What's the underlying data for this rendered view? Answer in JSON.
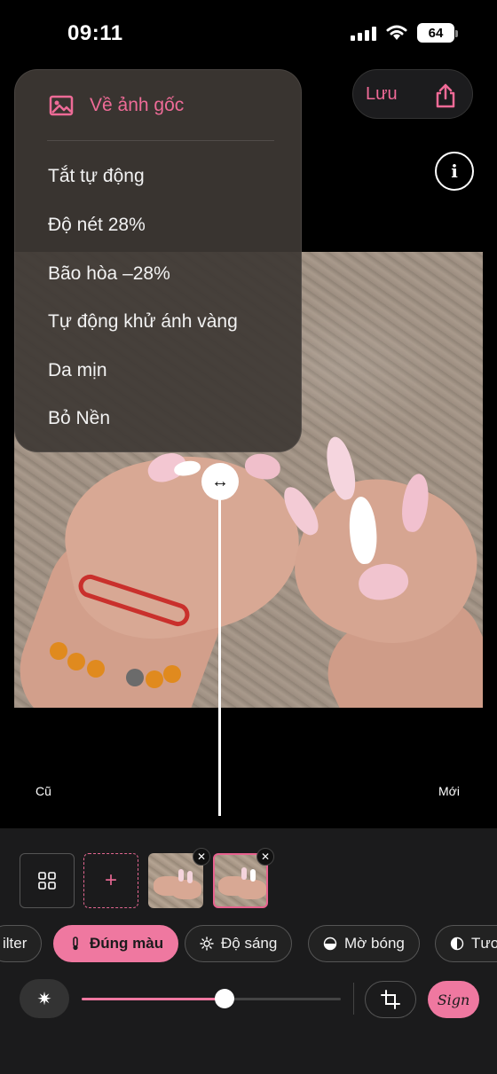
{
  "status_bar": {
    "time": "09:11",
    "battery": "64"
  },
  "top": {
    "save_label": "Lưu",
    "info_label": "i"
  },
  "menu": {
    "header_label": "Về ảnh gốc",
    "items": [
      "Tắt tự động",
      "Độ nét 28%",
      "Bão hòa –28%",
      "Tự động khử ánh vàng",
      "Da mịn",
      "Bỏ Nền"
    ]
  },
  "compare": {
    "old_label": "Cũ",
    "new_label": "Mới",
    "knob_glyph": "↔"
  },
  "tools": {
    "add_glyph": "+",
    "remove_glyph": "✕"
  },
  "filters": [
    {
      "label": "ilter",
      "icon": ""
    },
    {
      "label": "Đúng màu",
      "icon": "thermometer-icon"
    },
    {
      "label": "Độ sáng",
      "icon": "sun-icon"
    },
    {
      "label": "Mờ bóng",
      "icon": "half-circle-icon"
    },
    {
      "label": "Tươ",
      "icon": "contrast-icon"
    }
  ],
  "slider": {
    "value": 0.55
  },
  "bottom_tools": {
    "auto_glyph": "✷",
    "sign_label": "Sign"
  },
  "colors": {
    "accent": "#ef78a0",
    "panel": "#1b1b1c"
  }
}
